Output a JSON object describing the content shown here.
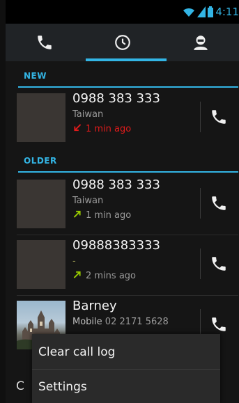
{
  "status_bar": {
    "time": "4:11",
    "icons": [
      "wifi-icon",
      "signal-icon",
      "battery-icon"
    ]
  },
  "tabs": [
    {
      "name": "phone-tab",
      "icon": "phone-icon",
      "selected": false
    },
    {
      "name": "call-log-tab",
      "icon": "clock-icon",
      "selected": true
    },
    {
      "name": "contacts-tab",
      "icon": "person-icon",
      "selected": false
    }
  ],
  "sections": {
    "new": "NEW",
    "older": "OLDER"
  },
  "calls": [
    {
      "number": "0988 383 333",
      "location": "Taiwan",
      "time": "1 min ago",
      "type": "missed"
    },
    {
      "number": "0988 383 333",
      "location": "Taiwan",
      "time": "1 min ago",
      "type": "outgoing"
    },
    {
      "number": "09888383333",
      "location": "-",
      "time": "2 mins ago",
      "type": "outgoing"
    },
    {
      "name": "Barney",
      "label": "Mobile",
      "number": "02 2171 5628"
    }
  ],
  "menu": {
    "items": [
      "Clear call log",
      "Settings"
    ]
  },
  "search_peek": "C",
  "colors": {
    "accent": "#33b5e5",
    "missed": "#e11b1b",
    "outgoing": "#99cc00"
  }
}
